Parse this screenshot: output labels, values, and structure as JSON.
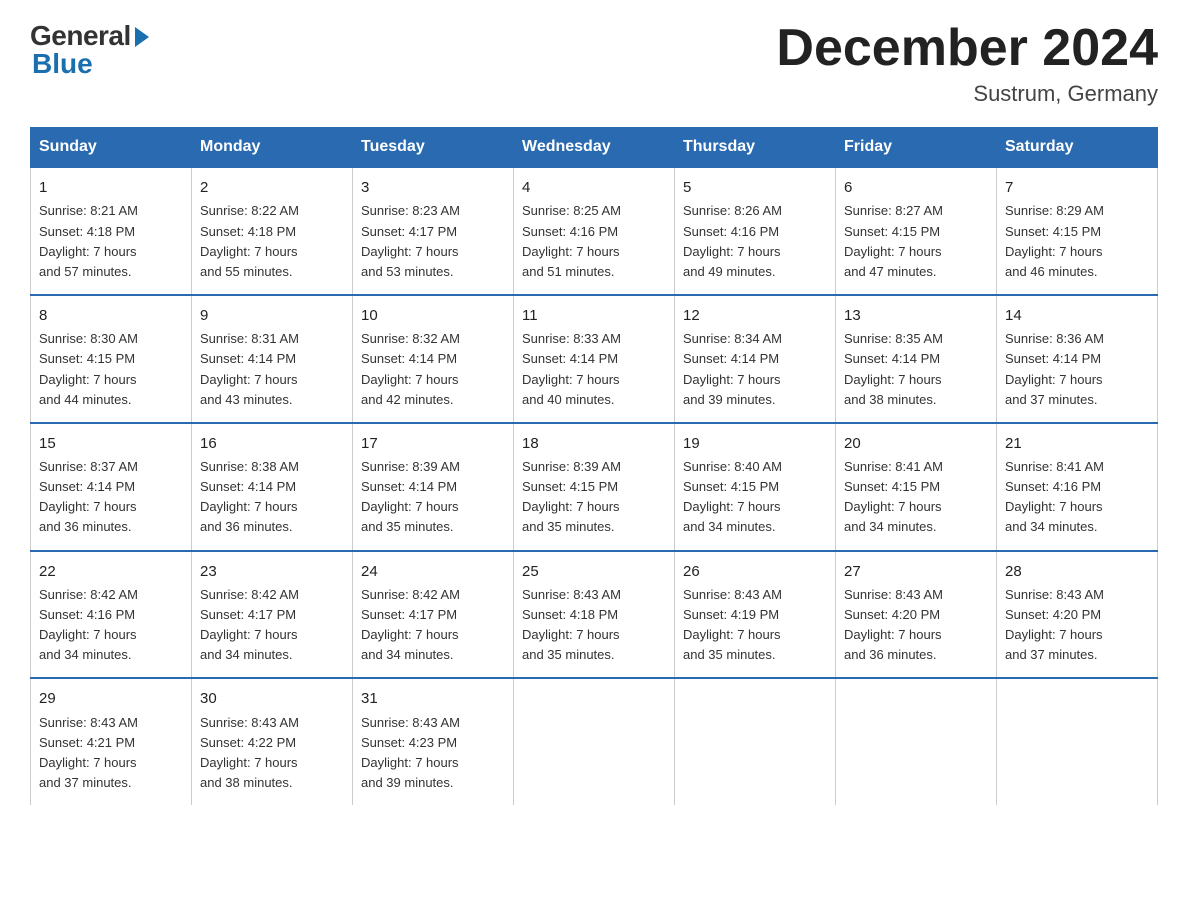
{
  "logo": {
    "general": "General",
    "blue": "Blue"
  },
  "title": "December 2024",
  "location": "Sustrum, Germany",
  "weekdays": [
    "Sunday",
    "Monday",
    "Tuesday",
    "Wednesday",
    "Thursday",
    "Friday",
    "Saturday"
  ],
  "weeks": [
    [
      {
        "day": "1",
        "sunrise": "8:21 AM",
        "sunset": "4:18 PM",
        "daylight": "7 hours and 57 minutes."
      },
      {
        "day": "2",
        "sunrise": "8:22 AM",
        "sunset": "4:18 PM",
        "daylight": "7 hours and 55 minutes."
      },
      {
        "day": "3",
        "sunrise": "8:23 AM",
        "sunset": "4:17 PM",
        "daylight": "7 hours and 53 minutes."
      },
      {
        "day": "4",
        "sunrise": "8:25 AM",
        "sunset": "4:16 PM",
        "daylight": "7 hours and 51 minutes."
      },
      {
        "day": "5",
        "sunrise": "8:26 AM",
        "sunset": "4:16 PM",
        "daylight": "7 hours and 49 minutes."
      },
      {
        "day": "6",
        "sunrise": "8:27 AM",
        "sunset": "4:15 PM",
        "daylight": "7 hours and 47 minutes."
      },
      {
        "day": "7",
        "sunrise": "8:29 AM",
        "sunset": "4:15 PM",
        "daylight": "7 hours and 46 minutes."
      }
    ],
    [
      {
        "day": "8",
        "sunrise": "8:30 AM",
        "sunset": "4:15 PM",
        "daylight": "7 hours and 44 minutes."
      },
      {
        "day": "9",
        "sunrise": "8:31 AM",
        "sunset": "4:14 PM",
        "daylight": "7 hours and 43 minutes."
      },
      {
        "day": "10",
        "sunrise": "8:32 AM",
        "sunset": "4:14 PM",
        "daylight": "7 hours and 42 minutes."
      },
      {
        "day": "11",
        "sunrise": "8:33 AM",
        "sunset": "4:14 PM",
        "daylight": "7 hours and 40 minutes."
      },
      {
        "day": "12",
        "sunrise": "8:34 AM",
        "sunset": "4:14 PM",
        "daylight": "7 hours and 39 minutes."
      },
      {
        "day": "13",
        "sunrise": "8:35 AM",
        "sunset": "4:14 PM",
        "daylight": "7 hours and 38 minutes."
      },
      {
        "day": "14",
        "sunrise": "8:36 AM",
        "sunset": "4:14 PM",
        "daylight": "7 hours and 37 minutes."
      }
    ],
    [
      {
        "day": "15",
        "sunrise": "8:37 AM",
        "sunset": "4:14 PM",
        "daylight": "7 hours and 36 minutes."
      },
      {
        "day": "16",
        "sunrise": "8:38 AM",
        "sunset": "4:14 PM",
        "daylight": "7 hours and 36 minutes."
      },
      {
        "day": "17",
        "sunrise": "8:39 AM",
        "sunset": "4:14 PM",
        "daylight": "7 hours and 35 minutes."
      },
      {
        "day": "18",
        "sunrise": "8:39 AM",
        "sunset": "4:15 PM",
        "daylight": "7 hours and 35 minutes."
      },
      {
        "day": "19",
        "sunrise": "8:40 AM",
        "sunset": "4:15 PM",
        "daylight": "7 hours and 34 minutes."
      },
      {
        "day": "20",
        "sunrise": "8:41 AM",
        "sunset": "4:15 PM",
        "daylight": "7 hours and 34 minutes."
      },
      {
        "day": "21",
        "sunrise": "8:41 AM",
        "sunset": "4:16 PM",
        "daylight": "7 hours and 34 minutes."
      }
    ],
    [
      {
        "day": "22",
        "sunrise": "8:42 AM",
        "sunset": "4:16 PM",
        "daylight": "7 hours and 34 minutes."
      },
      {
        "day": "23",
        "sunrise": "8:42 AM",
        "sunset": "4:17 PM",
        "daylight": "7 hours and 34 minutes."
      },
      {
        "day": "24",
        "sunrise": "8:42 AM",
        "sunset": "4:17 PM",
        "daylight": "7 hours and 34 minutes."
      },
      {
        "day": "25",
        "sunrise": "8:43 AM",
        "sunset": "4:18 PM",
        "daylight": "7 hours and 35 minutes."
      },
      {
        "day": "26",
        "sunrise": "8:43 AM",
        "sunset": "4:19 PM",
        "daylight": "7 hours and 35 minutes."
      },
      {
        "day": "27",
        "sunrise": "8:43 AM",
        "sunset": "4:20 PM",
        "daylight": "7 hours and 36 minutes."
      },
      {
        "day": "28",
        "sunrise": "8:43 AM",
        "sunset": "4:20 PM",
        "daylight": "7 hours and 37 minutes."
      }
    ],
    [
      {
        "day": "29",
        "sunrise": "8:43 AM",
        "sunset": "4:21 PM",
        "daylight": "7 hours and 37 minutes."
      },
      {
        "day": "30",
        "sunrise": "8:43 AM",
        "sunset": "4:22 PM",
        "daylight": "7 hours and 38 minutes."
      },
      {
        "day": "31",
        "sunrise": "8:43 AM",
        "sunset": "4:23 PM",
        "daylight": "7 hours and 39 minutes."
      },
      null,
      null,
      null,
      null
    ]
  ],
  "labels": {
    "sunrise": "Sunrise:",
    "sunset": "Sunset:",
    "daylight": "Daylight:"
  }
}
